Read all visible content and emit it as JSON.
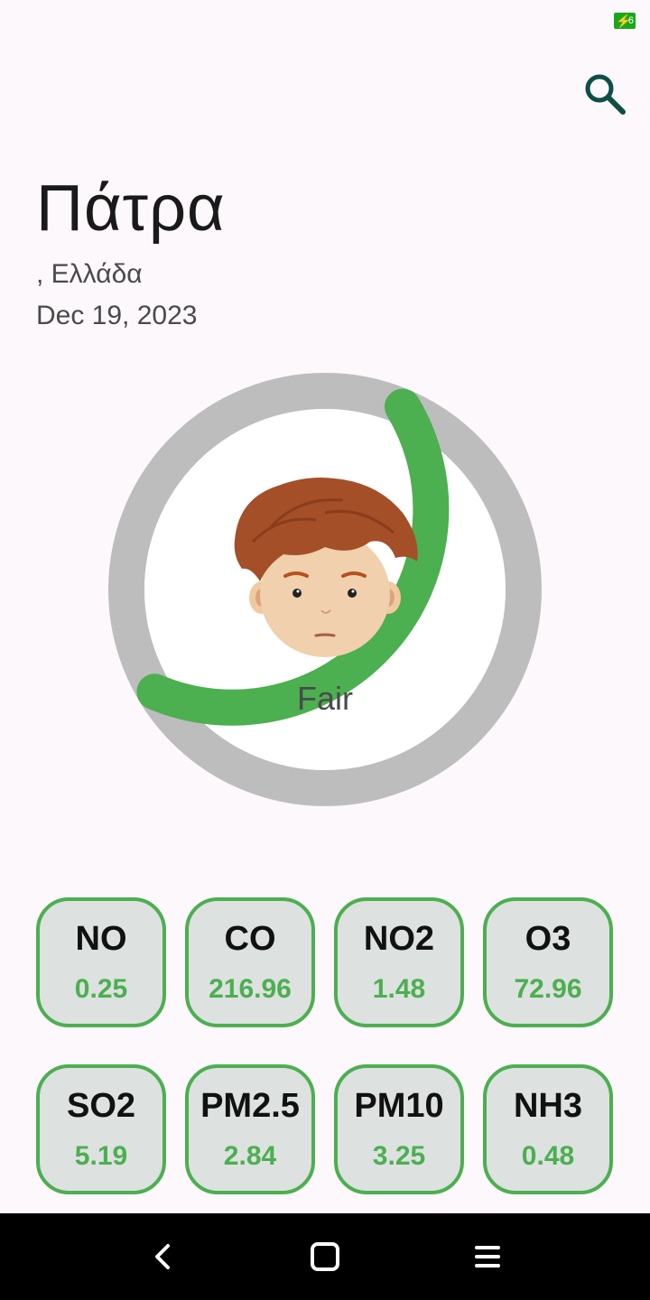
{
  "status_bar": {
    "battery_level": "6"
  },
  "header": {
    "search_icon": "search-icon"
  },
  "location": {
    "city": "Πάτρα",
    "country": ", Ελλάδα",
    "date": "Dec 19, 2023"
  },
  "aqi": {
    "label": "Fair",
    "progress_fraction": 0.4,
    "track_color": "#bdbdbd",
    "progress_color": "#4caf50"
  },
  "pollutants": [
    {
      "name": "NO",
      "value": "0.25"
    },
    {
      "name": "CO",
      "value": "216.96"
    },
    {
      "name": "NO2",
      "value": "1.48"
    },
    {
      "name": "O3",
      "value": "72.96"
    },
    {
      "name": "SO2",
      "value": "5.19"
    },
    {
      "name": "PM2.5",
      "value": "2.84"
    },
    {
      "name": "PM10",
      "value": "3.25"
    },
    {
      "name": "NH3",
      "value": "0.48"
    }
  ],
  "colors": {
    "accent": "#4caf50",
    "card_background": "#dde1e0",
    "search_icon": "#0d4f46",
    "page_background": "#fdf8fb"
  },
  "navigation": {
    "back_icon": "chevron-left-icon",
    "home_icon": "square-icon",
    "recents_icon": "menu-icon"
  }
}
